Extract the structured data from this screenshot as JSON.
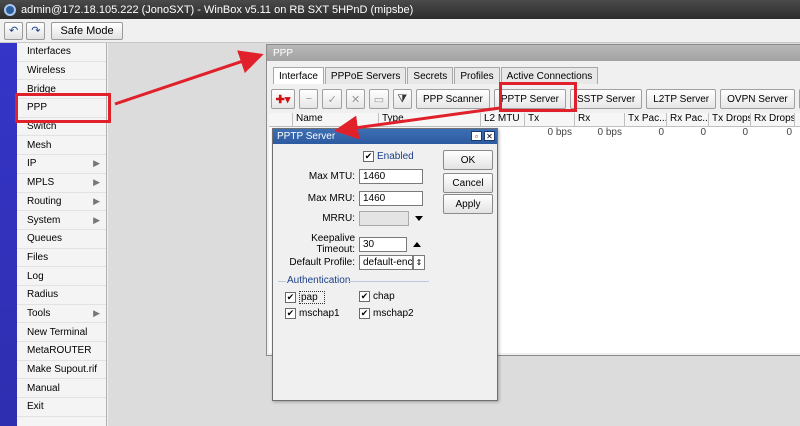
{
  "window": {
    "title": "admin@172.18.105.222 (JonoSXT) - WinBox v5.11 on RB SXT 5HPnD (mipsbe)"
  },
  "toolbar": {
    "undo_icon": "undo-icon",
    "redo_icon": "redo-icon",
    "safe_mode": "Safe Mode"
  },
  "sidebar": {
    "items": [
      {
        "label": "Interfaces",
        "arrow": false
      },
      {
        "label": "Wireless",
        "arrow": false
      },
      {
        "label": "Bridge",
        "arrow": false
      },
      {
        "label": "PPP",
        "arrow": false
      },
      {
        "label": "Switch",
        "arrow": false
      },
      {
        "label": "Mesh",
        "arrow": false
      },
      {
        "label": "IP",
        "arrow": true
      },
      {
        "label": "MPLS",
        "arrow": true
      },
      {
        "label": "Routing",
        "arrow": true
      },
      {
        "label": "System",
        "arrow": true
      },
      {
        "label": "Queues",
        "arrow": false
      },
      {
        "label": "Files",
        "arrow": false
      },
      {
        "label": "Log",
        "arrow": false
      },
      {
        "label": "Radius",
        "arrow": false
      },
      {
        "label": "Tools",
        "arrow": true
      },
      {
        "label": "New Terminal",
        "arrow": false
      },
      {
        "label": "MetaROUTER",
        "arrow": false
      },
      {
        "label": "Make Supout.rif",
        "arrow": false
      },
      {
        "label": "Manual",
        "arrow": false
      },
      {
        "label": "Exit",
        "arrow": false
      }
    ]
  },
  "ppp": {
    "title": "PPP",
    "tabs": [
      "Interface",
      "PPPoE Servers",
      "Secrets",
      "Profiles",
      "Active Connections"
    ],
    "active_tab": "Interface",
    "buttons": [
      "PPP Scanner",
      "PPTP Server",
      "SSTP Server",
      "L2TP Server",
      "OVPN Server"
    ],
    "columns": [
      "Name",
      "Type",
      "L2 MTU",
      "Tx",
      "Rx",
      "Tx Pac...",
      "Rx Pac...",
      "Tx Drops",
      "Rx Drops"
    ],
    "row": [
      "0 bps",
      "0 bps",
      "0",
      "0",
      "0",
      "0"
    ]
  },
  "pptp": {
    "title": "PPTP Server",
    "enabled_label": "Enabled",
    "enabled": true,
    "max_mtu_label": "Max MTU:",
    "max_mtu": "1460",
    "max_mru_label": "Max MRU:",
    "max_mru": "1460",
    "mrru_label": "MRRU:",
    "mrru": "",
    "keepalive_label": "Keepalive Timeout:",
    "keepalive": "30",
    "profile_label": "Default Profile:",
    "profile": "default-encr",
    "auth_label": "Authentication",
    "auth": [
      {
        "label": "pap",
        "checked": true
      },
      {
        "label": "chap",
        "checked": true
      },
      {
        "label": "mschap1",
        "checked": true
      },
      {
        "label": "mschap2",
        "checked": true
      }
    ],
    "ok": "OK",
    "cancel": "Cancel",
    "apply": "Apply"
  },
  "colors": {
    "annotation": "#e0202a",
    "strip": "#3232c0",
    "dialog_title": "#3564a9"
  }
}
